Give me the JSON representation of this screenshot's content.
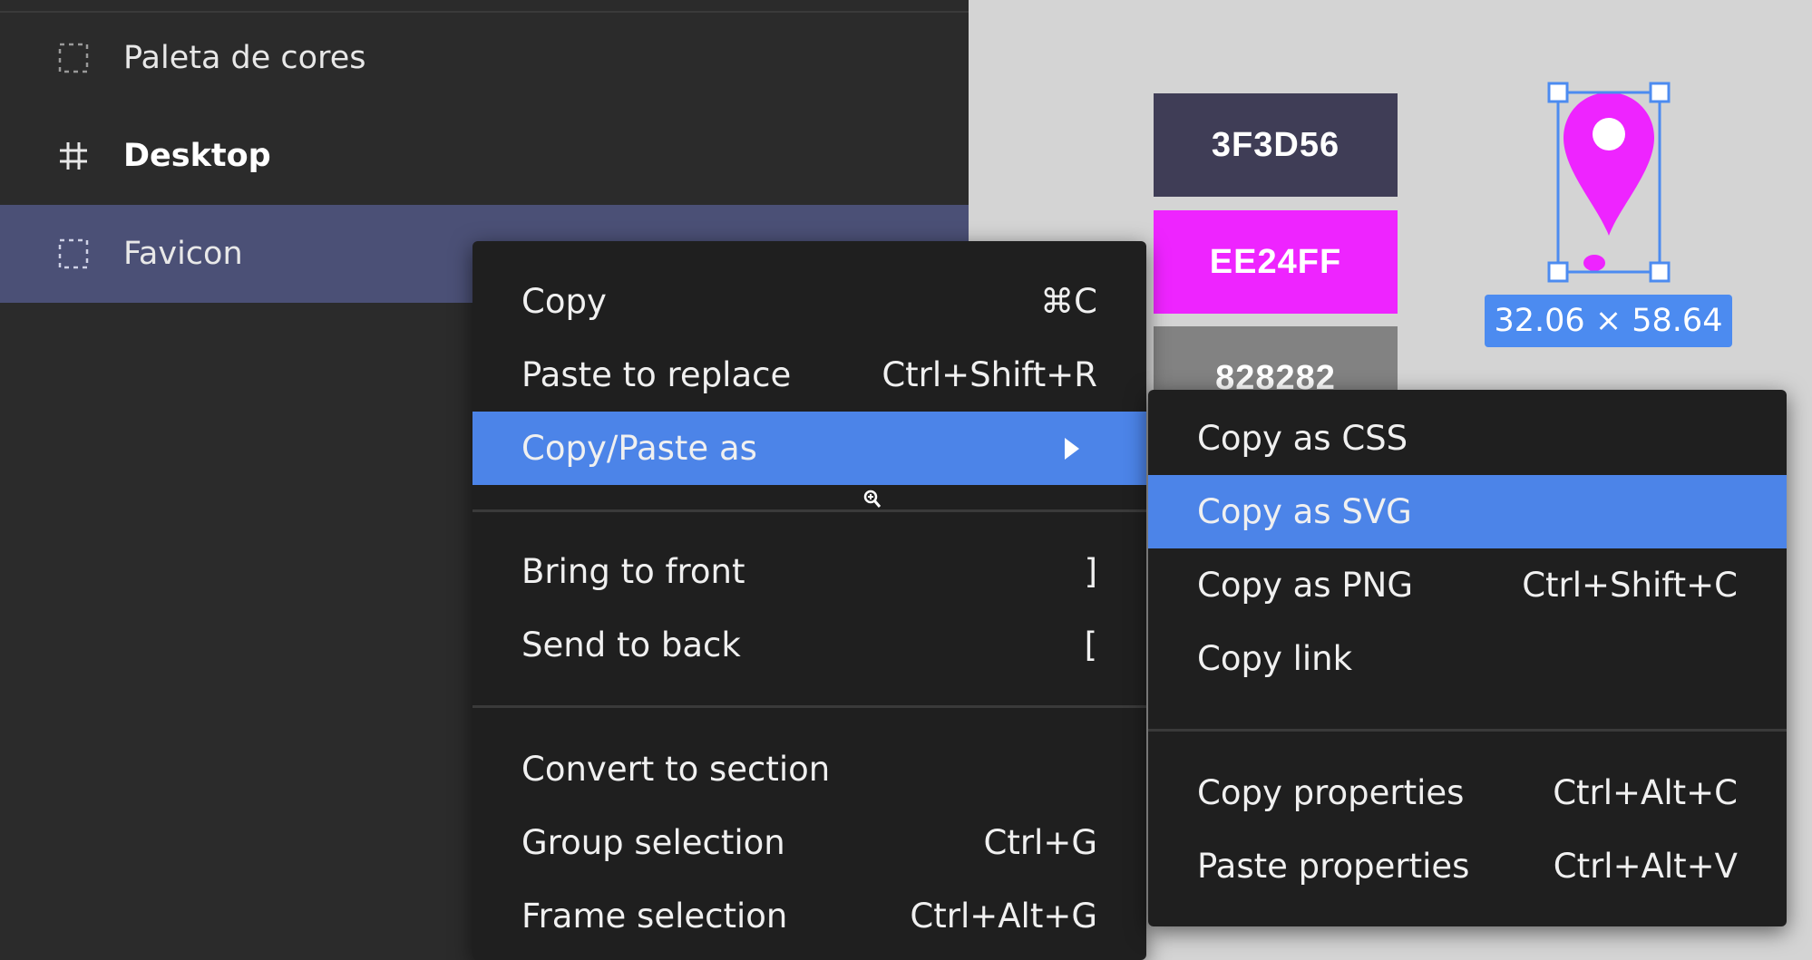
{
  "layers": {
    "items": [
      {
        "label": "Paleta de cores",
        "icon": "dashed-frame-icon"
      },
      {
        "label": "Desktop",
        "icon": "frame-hash-icon"
      },
      {
        "label": "Favicon",
        "icon": "dashed-frame-icon"
      }
    ]
  },
  "canvas": {
    "swatches": [
      {
        "label": "3F3D56",
        "color": "#3F3D56"
      },
      {
        "label": "EE24FF",
        "color": "#EE24FF"
      },
      {
        "label": "828282",
        "color": "#828282"
      }
    ],
    "dimension_badge": "32.06 × 58.64",
    "marker_color": "#EE24FF",
    "selection_color": "#4C8BF0"
  },
  "context_menu": {
    "copy": {
      "label": "Copy",
      "shortcut": "⌘C"
    },
    "paste_replace": {
      "label": "Paste to replace",
      "shortcut": "Ctrl+Shift+R"
    },
    "copy_paste_as": {
      "label": "Copy/Paste as"
    },
    "bring_front": {
      "label": "Bring to front",
      "shortcut": "]"
    },
    "send_back": {
      "label": "Send to back",
      "shortcut": "["
    },
    "convert_section": {
      "label": "Convert to section"
    },
    "group_selection": {
      "label": "Group selection",
      "shortcut": "Ctrl+G"
    },
    "frame_selection": {
      "label": "Frame selection",
      "shortcut": "Ctrl+Alt+G"
    }
  },
  "submenu": {
    "copy_css": {
      "label": "Copy as CSS"
    },
    "copy_svg": {
      "label": "Copy as SVG"
    },
    "copy_png": {
      "label": "Copy as PNG",
      "shortcut": "Ctrl+Shift+C"
    },
    "copy_link": {
      "label": "Copy link"
    },
    "copy_properties": {
      "label": "Copy properties",
      "shortcut": "Ctrl+Alt+C"
    },
    "paste_properties": {
      "label": "Paste properties",
      "shortcut": "Ctrl+Alt+V"
    }
  },
  "colors": {
    "menu_highlight": "#4C84E8",
    "selected_layer": "#4B5076",
    "panel_bg": "#2B2B2B"
  }
}
